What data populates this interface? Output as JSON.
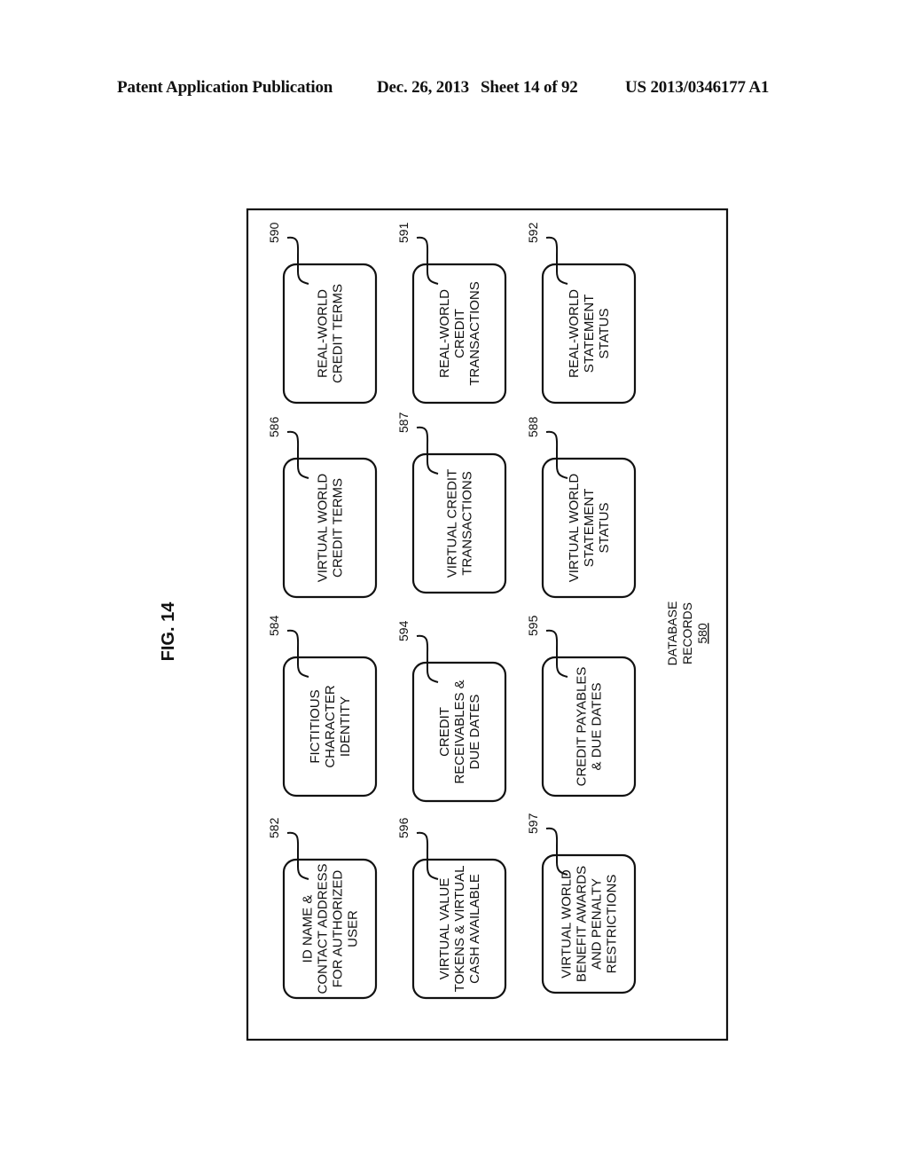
{
  "header": {
    "publication": "Patent Application Publication",
    "date": "Dec. 26, 2013",
    "sheet": "Sheet 14 of 92",
    "number": "US 2013/0346177 A1"
  },
  "figure": {
    "label": "FIG. 14",
    "container_label_lines": [
      "DATABASE",
      "RECORDS"
    ],
    "container_ref": "580"
  },
  "records": [
    {
      "ref": "590",
      "lines": [
        "REAL-WORLD",
        "CREDIT TERMS"
      ]
    },
    {
      "ref": "591",
      "lines": [
        "REAL-WORLD",
        "CREDIT",
        "TRANSACTIONS"
      ]
    },
    {
      "ref": "592",
      "lines": [
        "REAL-WORLD",
        "STATEMENT",
        "STATUS"
      ]
    },
    {
      "ref": "586",
      "lines": [
        "VIRTUAL WORLD",
        "CREDIT TERMS"
      ]
    },
    {
      "ref": "587",
      "lines": [
        "VIRTUAL CREDIT",
        "TRANSACTIONS"
      ]
    },
    {
      "ref": "588",
      "lines": [
        "VIRTUAL WORLD",
        "STATEMENT",
        "STATUS"
      ]
    },
    {
      "ref": "584",
      "lines": [
        "FICTITIOUS",
        "CHARACTER",
        "IDENTITY"
      ]
    },
    {
      "ref": "594",
      "lines": [
        "CREDIT",
        "RECEIVABLES &",
        "DUE DATES"
      ]
    },
    {
      "ref": "595",
      "lines": [
        "CREDIT PAYABLES",
        "& DUE DATES"
      ]
    },
    {
      "ref": "582",
      "lines": [
        "ID NAME &",
        "CONTACT ADDRESS",
        "FOR AUTHORIZED",
        "USER"
      ]
    },
    {
      "ref": "596",
      "lines": [
        "VIRTUAL VALUE",
        "TOKENS & VIRTUAL",
        "CASH AVAILABLE"
      ]
    },
    {
      "ref": "597",
      "lines": [
        "VIRTUAL WORLD",
        "BENEFIT AWARDS",
        "AND PENALTY",
        "RESTRICTIONS"
      ]
    }
  ]
}
